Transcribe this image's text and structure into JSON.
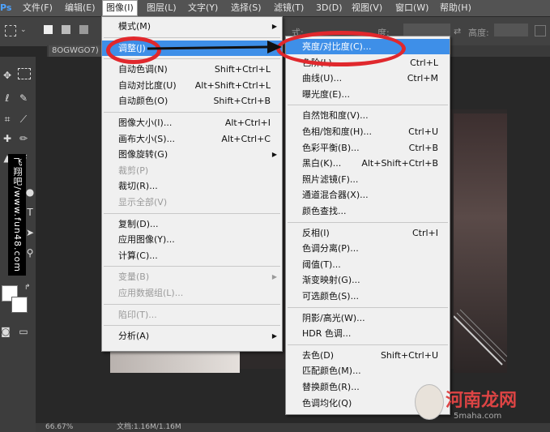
{
  "menubar": {
    "logo": "Ps",
    "items": [
      "文件(F)",
      "编辑(E)",
      "图像(I)",
      "图层(L)",
      "文字(Y)",
      "选择(S)",
      "滤镜(T)",
      "3D(D)",
      "视图(V)",
      "窗口(W)",
      "帮助(H)"
    ]
  },
  "options": {
    "width_label": "宽度:",
    "height_label": "高度:",
    "mode_partial": "式:",
    "unit_partial": "度:"
  },
  "doc_tab": "8OGWGO7)",
  "status": {
    "zoom": "66.67%",
    "doc": "文档:1.16M/1.16M"
  },
  "image_menu": [
    {
      "label": "模式(M)",
      "shortcut": "",
      "submenu": true
    },
    {
      "sep": true
    },
    {
      "label": "调整(J)",
      "shortcut": "",
      "submenu": true,
      "highlighted": true
    },
    {
      "sep": true
    },
    {
      "label": "自动色调(N)",
      "shortcut": "Shift+Ctrl+L"
    },
    {
      "label": "自动对比度(U)",
      "shortcut": "Alt+Shift+Ctrl+L"
    },
    {
      "label": "自动颜色(O)",
      "shortcut": "Shift+Ctrl+B"
    },
    {
      "sep": true
    },
    {
      "label": "图像大小(I)...",
      "shortcut": "Alt+Ctrl+I"
    },
    {
      "label": "画布大小(S)...",
      "shortcut": "Alt+Ctrl+C"
    },
    {
      "label": "图像旋转(G)",
      "shortcut": "",
      "submenu": true
    },
    {
      "label": "裁剪(P)",
      "shortcut": "",
      "disabled": true
    },
    {
      "label": "裁切(R)...",
      "shortcut": ""
    },
    {
      "label": "显示全部(V)",
      "shortcut": "",
      "disabled": true
    },
    {
      "sep": true
    },
    {
      "label": "复制(D)...",
      "shortcut": ""
    },
    {
      "label": "应用图像(Y)...",
      "shortcut": ""
    },
    {
      "label": "计算(C)...",
      "shortcut": ""
    },
    {
      "sep": true
    },
    {
      "label": "变量(B)",
      "shortcut": "",
      "submenu": true,
      "disabled": true
    },
    {
      "label": "应用数据组(L)...",
      "shortcut": "",
      "disabled": true
    },
    {
      "sep": true
    },
    {
      "label": "陷印(T)...",
      "shortcut": "",
      "disabled": true
    },
    {
      "sep": true
    },
    {
      "label": "分析(A)",
      "shortcut": "",
      "submenu": true
    }
  ],
  "adjust_menu": [
    {
      "label": "亮度/对比度(C)...",
      "shortcut": "",
      "highlighted": true
    },
    {
      "label": "色阶(L)...",
      "shortcut": "Ctrl+L"
    },
    {
      "label": "曲线(U)...",
      "shortcut": "Ctrl+M"
    },
    {
      "label": "曝光度(E)...",
      "shortcut": ""
    },
    {
      "sep": true
    },
    {
      "label": "自然饱和度(V)...",
      "shortcut": ""
    },
    {
      "label": "色相/饱和度(H)...",
      "shortcut": "Ctrl+U"
    },
    {
      "label": "色彩平衡(B)...",
      "shortcut": "Ctrl+B"
    },
    {
      "label": "黑白(K)...",
      "shortcut": "Alt+Shift+Ctrl+B"
    },
    {
      "label": "照片滤镜(F)...",
      "shortcut": ""
    },
    {
      "label": "通道混合器(X)...",
      "shortcut": ""
    },
    {
      "label": "颜色查找...",
      "shortcut": ""
    },
    {
      "sep": true
    },
    {
      "label": "反相(I)",
      "shortcut": "Ctrl+I"
    },
    {
      "label": "色调分离(P)...",
      "shortcut": ""
    },
    {
      "label": "阈值(T)...",
      "shortcut": ""
    },
    {
      "label": "渐变映射(G)...",
      "shortcut": ""
    },
    {
      "label": "可选颜色(S)...",
      "shortcut": ""
    },
    {
      "sep": true
    },
    {
      "label": "阴影/高光(W)...",
      "shortcut": ""
    },
    {
      "label": "HDR 色调...",
      "shortcut": ""
    },
    {
      "sep": true
    },
    {
      "label": "去色(D)",
      "shortcut": "Shift+Ctrl+U"
    },
    {
      "label": "匹配颜色(M)...",
      "shortcut": ""
    },
    {
      "label": "替换颜色(R)...",
      "shortcut": ""
    },
    {
      "label": "色调均化(Q)",
      "shortcut": ""
    }
  ],
  "watermarks": {
    "side": "飞翔吧/www.fun48.com",
    "logo": "河南龙网",
    "logo_sub": "5maha.com"
  },
  "colors": {
    "highlight": "#3e8fe8",
    "annotation": "#e0282d"
  }
}
